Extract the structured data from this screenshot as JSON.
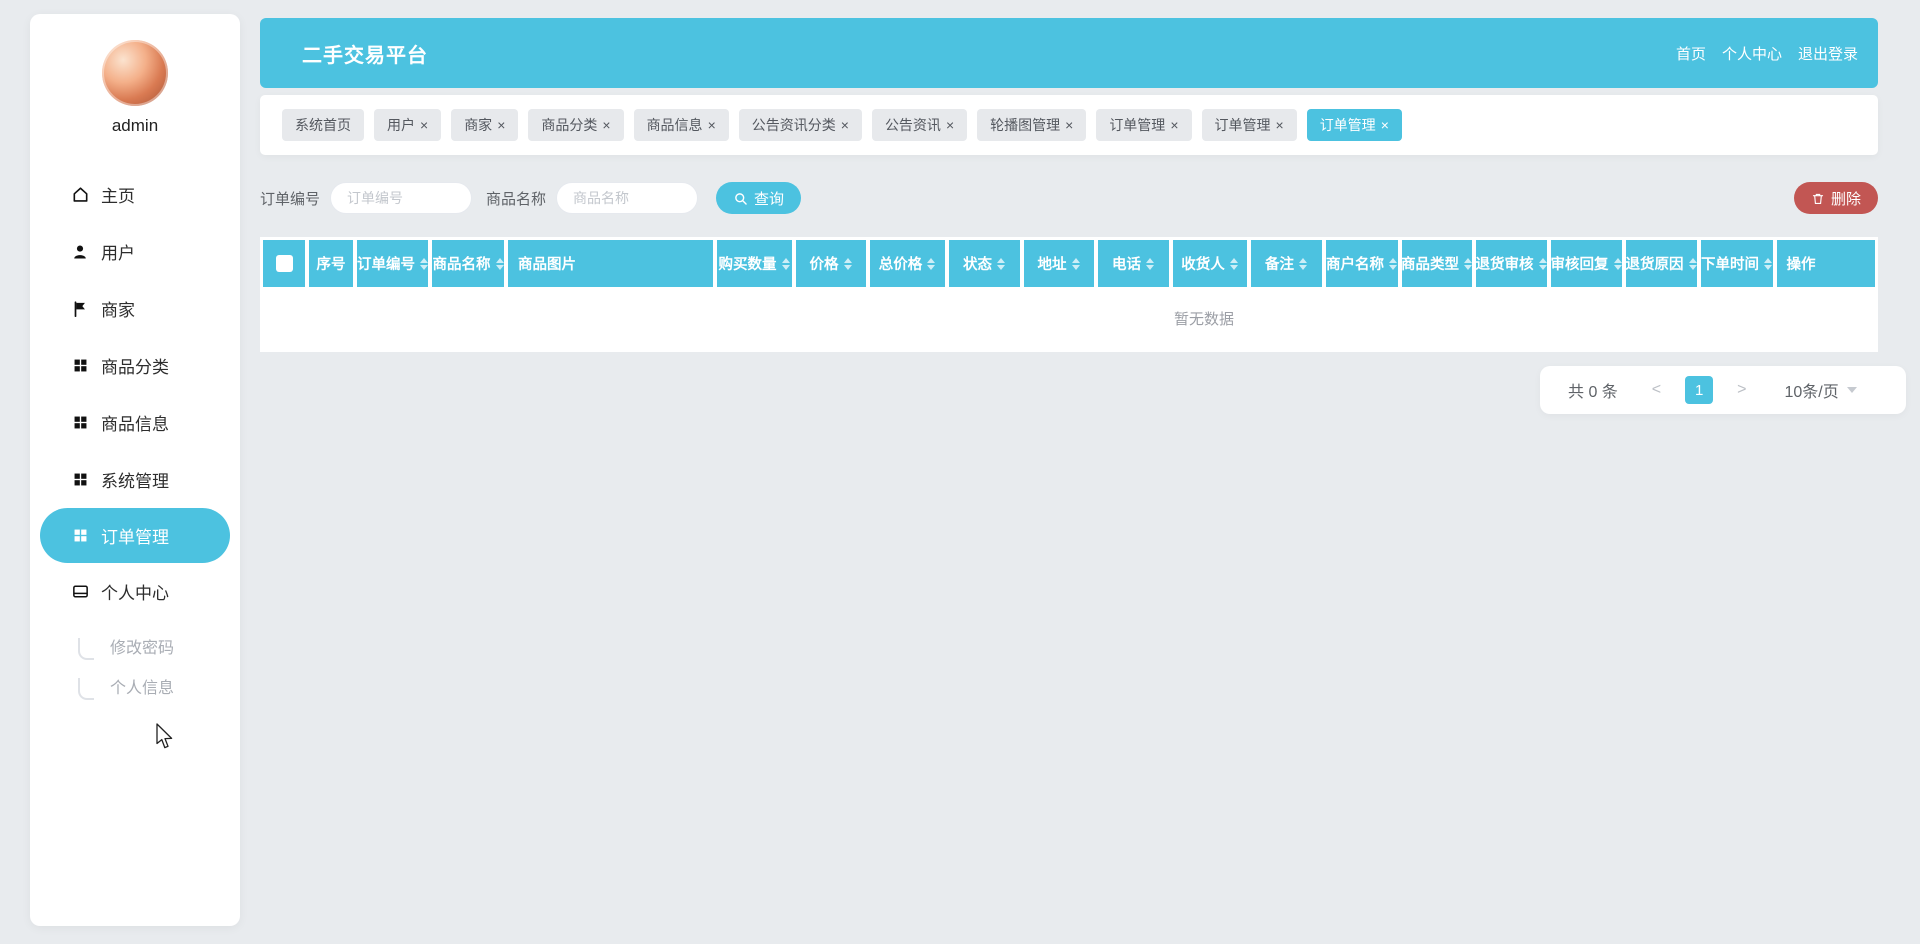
{
  "header": {
    "title": "二手交易平台",
    "links": [
      "首页",
      "个人中心",
      "退出登录"
    ]
  },
  "sidebar": {
    "username": "admin",
    "items": [
      {
        "label": "主页",
        "icon": "home-icon",
        "active": false
      },
      {
        "label": "用户",
        "icon": "user-icon",
        "active": false
      },
      {
        "label": "商家",
        "icon": "flag-icon",
        "active": false
      },
      {
        "label": "商品分类",
        "icon": "grid-icon",
        "active": false
      },
      {
        "label": "商品信息",
        "icon": "grid-icon",
        "active": false
      },
      {
        "label": "系统管理",
        "icon": "grid-icon",
        "active": false
      },
      {
        "label": "订单管理",
        "icon": "grid-icon",
        "active": true
      },
      {
        "label": "个人中心",
        "icon": "card-icon",
        "active": false
      }
    ],
    "sub_items": [
      "修改密码",
      "个人信息"
    ]
  },
  "tabs": [
    {
      "label": "系统首页",
      "closable": false,
      "active": false
    },
    {
      "label": "用户",
      "closable": true,
      "active": false
    },
    {
      "label": "商家",
      "closable": true,
      "active": false
    },
    {
      "label": "商品分类",
      "closable": true,
      "active": false
    },
    {
      "label": "商品信息",
      "closable": true,
      "active": false
    },
    {
      "label": "公告资讯分类",
      "closable": true,
      "active": false
    },
    {
      "label": "公告资讯",
      "closable": true,
      "active": false
    },
    {
      "label": "轮播图管理",
      "closable": true,
      "active": false
    },
    {
      "label": "订单管理",
      "closable": true,
      "active": false
    },
    {
      "label": "订单管理",
      "closable": true,
      "active": false
    },
    {
      "label": "订单管理",
      "closable": true,
      "active": true
    }
  ],
  "filters": {
    "order_no_label": "订单编号",
    "order_no_placeholder": "订单编号",
    "product_label": "商品名称",
    "product_placeholder": "商品名称",
    "search_label": "查询",
    "delete_label": "删除"
  },
  "table": {
    "columns": [
      {
        "label": "",
        "type": "checkbox",
        "sortable": false
      },
      {
        "label": "序号",
        "sortable": false
      },
      {
        "label": "订单编号",
        "sortable": true
      },
      {
        "label": "商品名称",
        "sortable": true
      },
      {
        "label": "商品图片",
        "sortable": false
      },
      {
        "label": "购买数量",
        "sortable": true
      },
      {
        "label": "价格",
        "sortable": true
      },
      {
        "label": "总价格",
        "sortable": true
      },
      {
        "label": "状态",
        "sortable": true
      },
      {
        "label": "地址",
        "sortable": true
      },
      {
        "label": "电话",
        "sortable": true
      },
      {
        "label": "收货人",
        "sortable": true
      },
      {
        "label": "备注",
        "sortable": true
      },
      {
        "label": "商户名称",
        "sortable": true
      },
      {
        "label": "商品类型",
        "sortable": true
      },
      {
        "label": "退货审核",
        "sortable": true
      },
      {
        "label": "审核回复",
        "sortable": true
      },
      {
        "label": "退货原因",
        "sortable": true
      },
      {
        "label": "下单时间",
        "sortable": true
      },
      {
        "label": "操作",
        "sortable": false
      }
    ],
    "rows": [],
    "empty_text": "暂无数据"
  },
  "pagination": {
    "total_text": "共 0 条",
    "prev_label": "<",
    "current_page": "1",
    "next_label": ">",
    "page_size_label": "10条/页"
  },
  "colors": {
    "primary": "#4cc2e0",
    "danger": "#c25653",
    "page_bg": "#e8ebee"
  }
}
